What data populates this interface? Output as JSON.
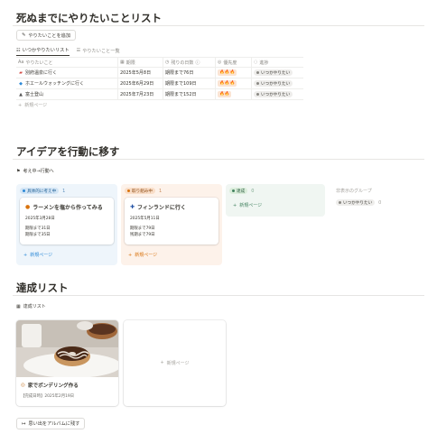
{
  "section1": {
    "title": "死ぬまでにやりたいことリスト",
    "add_button": "やりたいことを追加",
    "tabs": [
      {
        "label": "いつかやりたいリスト",
        "icon": "table-icon"
      },
      {
        "label": "やりたいこと一覧",
        "icon": "list-icon"
      }
    ],
    "columns": [
      "やりたいこと",
      "期限",
      "残りの日数",
      "優先度",
      "進捗"
    ],
    "column_icons": [
      "title-icon",
      "calendar-icon",
      "formula-icon",
      "select-icon",
      "status-icon"
    ],
    "rows": [
      {
        "icon": "car-icon",
        "name": "別府温泉に行く",
        "deadline": "2025年5月8日",
        "remaining": "期限まで76日",
        "priority": "🔥🔥🔥",
        "status": "いつかやりたい"
      },
      {
        "icon": "whale-icon",
        "name": "ホエールウォッチングに行く",
        "deadline": "2025年6月29日",
        "remaining": "期限まで109日",
        "priority": "🔥🔥🔥",
        "status": "いつかやりたい"
      },
      {
        "icon": "mountain-icon",
        "name": "富士登山",
        "deadline": "2025年7月23日",
        "remaining": "期限まで152日",
        "priority": "🔥🔥",
        "status": "いつかやりたい"
      }
    ],
    "new_page": "新規ページ"
  },
  "section2": {
    "title": "アイデアを行動に移す",
    "view_label": "考え中→行動へ",
    "columns": [
      {
        "label": "具体的に考え中",
        "count": "1",
        "color": "#2e8ad7",
        "bg": "#eef5fb",
        "tagbg": "#d3e5f5",
        "card": {
          "icon": "ramen-icon",
          "title": "ラーメンを塩から作ってみる",
          "date": "2025年3月28日",
          "lines": [
            "期限まで31日",
            "期限まで35日"
          ]
        },
        "new": "新規ページ"
      },
      {
        "label": "取り組み中",
        "count": "1",
        "color": "#d9730d",
        "bg": "#fdf2ea",
        "tagbg": "#f9dec9",
        "card": {
          "icon": "finland-flag-icon",
          "title": "フィンランドに行く",
          "date": "2025年5月11日",
          "lines": [
            "期限まで79日",
            "残期まで79日"
          ]
        },
        "new": "新規ページ"
      },
      {
        "label": "達成",
        "count": "0",
        "color": "#448361",
        "bg": "#f0f6f2",
        "tagbg": "#dbeddb",
        "new": "新規ページ"
      }
    ],
    "hidden_groups_label": "非表示のグループ",
    "hidden_tag": "いつかやりたい",
    "hidden_count": "0"
  },
  "section3": {
    "title": "達成リスト",
    "view_label": "達成リスト",
    "card": {
      "icon": "donut-icon",
      "title": "家でポンデリング作る",
      "meta": "【完成日時】2025年2月19日"
    },
    "new_page": "新規ページ",
    "album_button": "思い出をアルバムに残す"
  },
  "colors": {
    "text": "#37352f",
    "muted": "#8a8883",
    "divider": "#e6e5e3",
    "fire": "#c35a19"
  }
}
